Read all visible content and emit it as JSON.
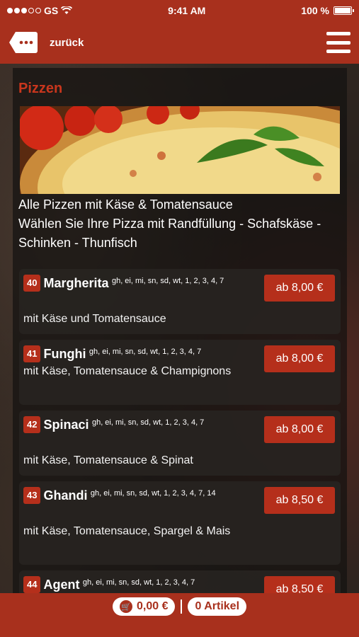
{
  "status": {
    "carrier": "GS",
    "time": "9:41 AM",
    "battery": "100 %"
  },
  "nav": {
    "back_label": "zurück"
  },
  "section": {
    "title": "Pizzen",
    "intro_line1": "Alle Pizzen mit Käse & Tomatensauce",
    "intro_line2": "Wählen Sie Ihre Pizza mit Randfüllung - Schafskäse - Schinken - Thunfisch"
  },
  "items": [
    {
      "num": "40",
      "name": "Margherita",
      "codes": "gh, ei, mi, sn, sd, wt, 1, 2, 3, 4, 7",
      "desc": "mit Käse und Tomatensauce",
      "price": "ab 8,00 €"
    },
    {
      "num": "41",
      "name": "Funghi",
      "codes": "gh, ei, mi, sn, sd, wt, 1, 2, 3, 4, 7",
      "desc": "mit Käse, Tomatensauce & Champignons",
      "price": "ab 8,00 €"
    },
    {
      "num": "42",
      "name": "Spinaci",
      "codes": "gh, ei, mi, sn, sd, wt, 1, 2, 3, 4, 7",
      "desc": "mit Käse, Tomatensauce & Spinat",
      "price": "ab 8,00 €"
    },
    {
      "num": "43",
      "name": "Ghandi",
      "codes": "gh, ei, mi, sn, sd, wt, 1, 2, 3, 4, 7, 14",
      "desc": "mit Käse, Tomatensauce, Spargel & Mais",
      "price": "ab 8,50 €"
    },
    {
      "num": "44",
      "name": "Agent",
      "codes": "gh, ei, mi, sn, sd, wt, 1, 2, 3, 4, 7",
      "desc": "",
      "price": "ab 8,50 €"
    }
  ],
  "cart": {
    "total": "0,00 €",
    "count": "0 Artikel"
  },
  "colors": {
    "accent": "#a8301d",
    "price": "#b52f1b",
    "title": "#c8361d"
  }
}
